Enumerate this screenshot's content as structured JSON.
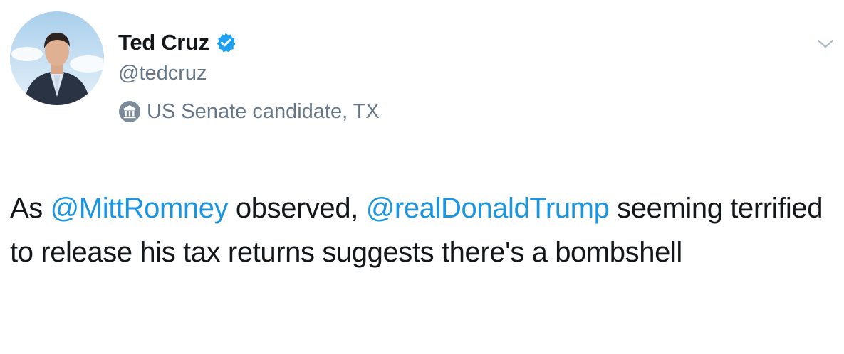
{
  "colors": {
    "text": "#14171a",
    "secondary": "#657786",
    "link": "#1b95e0",
    "verified": "#1da1f2"
  },
  "author": {
    "name": "Ted Cruz",
    "handle": "@tedcruz",
    "verified_icon": "verified-badge-icon",
    "avatar": "profile-photo"
  },
  "label": {
    "icon": "government-building-icon",
    "text": "US Senate candidate, TX"
  },
  "menu": {
    "icon": "chevron-down-icon"
  },
  "tweet": {
    "segments": [
      {
        "type": "text",
        "value": "As "
      },
      {
        "type": "mention",
        "value": "@MittRomney"
      },
      {
        "type": "text",
        "value": " observed, "
      },
      {
        "type": "mention",
        "value": "@realDonaldTrump"
      },
      {
        "type": "text",
        "value": " seeming terrified to release his tax returns suggests there's a bombshell"
      }
    ]
  }
}
